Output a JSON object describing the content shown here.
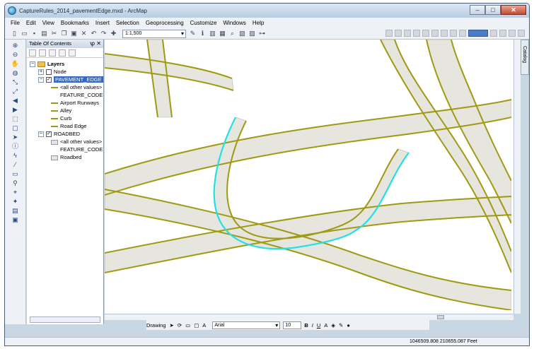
{
  "window": {
    "title": "CaptureRules_2014_pavementEdge.mxd - ArcMap"
  },
  "menu": [
    "File",
    "Edit",
    "View",
    "Bookmarks",
    "Insert",
    "Selection",
    "Geoprocessing",
    "Customize",
    "Windows",
    "Help"
  ],
  "toolbar": {
    "scale": "1:1,500"
  },
  "toc": {
    "title": "Table Of Contents",
    "layers_label": "Layers",
    "node_label": "Node",
    "pavement_label": "PAVEMENT_EDGE",
    "all_other_values": "<all other values>",
    "feature_code": "FEATURE_CODE",
    "classes": [
      "Airport Runways",
      "Alley",
      "Curb",
      "Road Edge"
    ],
    "roadbed_label": "ROADBED",
    "roadbed_all_other": "<all other values>",
    "roadbed_feature_code": "FEATURE_CODE",
    "roadbed_class": "Roadbed"
  },
  "catalog": {
    "label": "Catalog"
  },
  "drawing": {
    "label": "Drawing",
    "font": "Arial",
    "size": "10"
  },
  "status": {
    "coordinates": "1046509.808  210655.087 Feet"
  },
  "colors": {
    "road_fill": "#e6e5de",
    "road_outline": "#9f9a12",
    "selected": "#22e0e8",
    "selection_blue": "#3468c7"
  }
}
